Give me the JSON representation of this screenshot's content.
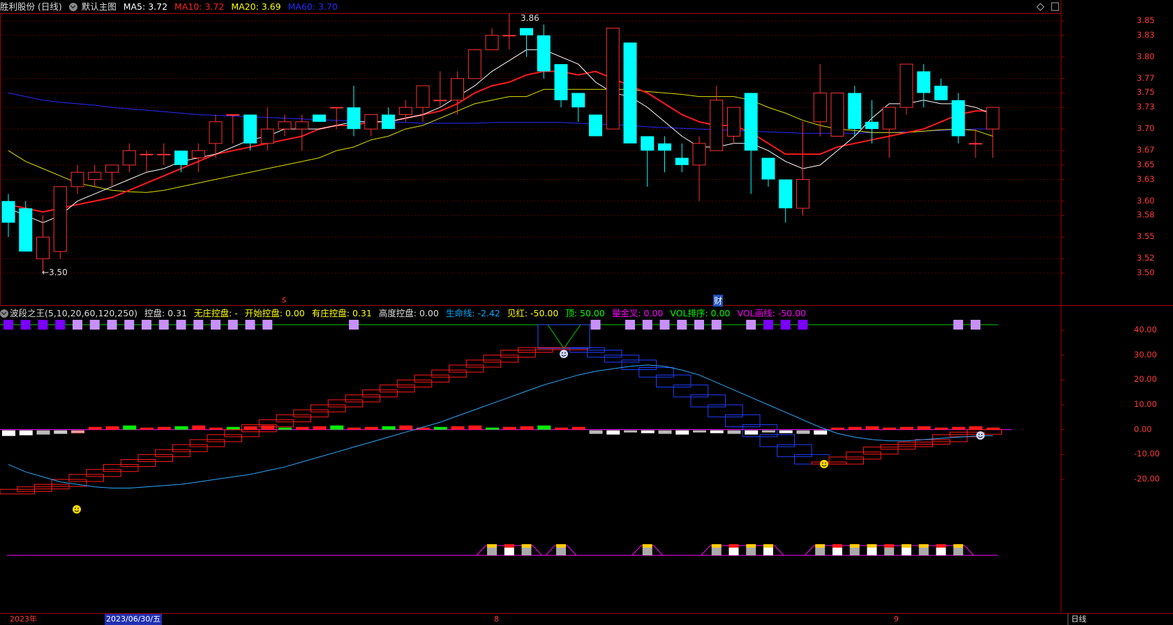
{
  "header": {
    "stock_title": "胜利股份 (日线)",
    "template_label": "默认主图",
    "ma5": {
      "label": "MA5:",
      "value": "3.72",
      "color": "#ffffff"
    },
    "ma10": {
      "label": "MA10:",
      "value": "3.72",
      "color": "#ff2020"
    },
    "ma20": {
      "label": "MA20:",
      "value": "3.69",
      "color": "#ffff00"
    },
    "ma60": {
      "label": "MA60:",
      "value": "3.70",
      "color": "#2020ff"
    }
  },
  "main_axis": {
    "ticks": [
      "3.85",
      "3.83",
      "3.80",
      "3.77",
      "3.75",
      "3.73",
      "3.70",
      "3.67",
      "3.65",
      "3.63",
      "3.60",
      "3.58",
      "3.55",
      "3.52",
      "3.50"
    ],
    "high_label": "3.86",
    "low_label": "←3.50",
    "marker_s": "s",
    "marker_cai": "财"
  },
  "sub1": {
    "title": "波段之王(5,10,20,60,120,250)",
    "items": [
      {
        "text": "控盘: 0.31",
        "color": "#dddddd"
      },
      {
        "text": "无庄控盘: -",
        "color": "#ffff00"
      },
      {
        "text": "开始控盘: 0.00",
        "color": "#ffff00"
      },
      {
        "text": "有庄控盘: 0.31",
        "color": "#ffff00"
      },
      {
        "text": "高度控盘: 0.00",
        "color": "#dddddd"
      },
      {
        "text": "生命线: -2.42",
        "color": "#00aaff"
      },
      {
        "text": "见红: -50.00",
        "color": "#ffff00"
      },
      {
        "text": "顶: 50.00",
        "color": "#00ff00"
      },
      {
        "text": "量金叉: 0.00",
        "color": "#ff00ff"
      },
      {
        "text": "VOL排序: 0.00",
        "color": "#00ff00"
      },
      {
        "text": "VOL画线: -50.00",
        "color": "#ff00ff"
      }
    ],
    "axis_ticks": [
      "40.00",
      "30.00",
      "20.00",
      "10.00",
      "0.00",
      "-10.00",
      "-20.00"
    ]
  },
  "bottom": {
    "year_label": "2023年",
    "date_label": "2023/06/30/五",
    "month8": "8",
    "month9": "9",
    "period_button": "日线"
  },
  "chart_data": {
    "type": "candlestick",
    "ylim": [
      3.49,
      3.86
    ],
    "colors": {
      "up": "#ff3232",
      "down": "#00ffff"
    },
    "candles": [
      [
        3.6,
        3.57,
        3.61,
        3.55
      ],
      [
        3.59,
        3.53,
        3.6,
        3.53
      ],
      [
        3.52,
        3.55,
        3.58,
        3.5
      ],
      [
        3.53,
        3.62,
        3.62,
        3.52
      ],
      [
        3.62,
        3.64,
        3.65,
        3.61
      ],
      [
        3.63,
        3.64,
        3.65,
        3.62
      ],
      [
        3.64,
        3.65,
        3.65,
        3.62
      ],
      [
        3.65,
        3.67,
        3.68,
        3.64
      ],
      [
        3.665,
        3.665,
        3.67,
        3.64
      ],
      [
        3.665,
        3.665,
        3.68,
        3.65
      ],
      [
        3.67,
        3.65,
        3.67,
        3.64
      ],
      [
        3.66,
        3.67,
        3.68,
        3.64
      ],
      [
        3.68,
        3.71,
        3.72,
        3.66
      ],
      [
        3.72,
        3.72,
        3.72,
        3.68
      ],
      [
        3.72,
        3.68,
        3.72,
        3.67
      ],
      [
        3.68,
        3.7,
        3.73,
        3.67
      ],
      [
        3.7,
        3.71,
        3.72,
        3.69
      ],
      [
        3.7,
        3.71,
        3.72,
        3.67
      ],
      [
        3.72,
        3.71,
        3.72,
        3.71
      ],
      [
        3.73,
        3.73,
        3.73,
        3.7
      ],
      [
        3.73,
        3.7,
        3.76,
        3.69
      ],
      [
        3.7,
        3.72,
        3.72,
        3.69
      ],
      [
        3.72,
        3.7,
        3.73,
        3.7
      ],
      [
        3.72,
        3.73,
        3.74,
        3.71
      ],
      [
        3.73,
        3.76,
        3.76,
        3.71
      ],
      [
        3.74,
        3.74,
        3.78,
        3.73
      ],
      [
        3.74,
        3.77,
        3.78,
        3.72
      ],
      [
        3.77,
        3.81,
        3.81,
        3.77
      ],
      [
        3.81,
        3.83,
        3.84,
        3.81
      ],
      [
        3.83,
        3.83,
        3.86,
        3.81
      ],
      [
        3.84,
        3.83,
        3.84,
        3.8
      ],
      [
        3.83,
        3.78,
        3.845,
        3.77
      ],
      [
        3.79,
        3.74,
        3.79,
        3.73
      ],
      [
        3.75,
        3.73,
        3.75,
        3.71
      ],
      [
        3.72,
        3.69,
        3.72,
        3.69
      ],
      [
        3.7,
        3.84,
        3.84,
        3.7
      ],
      [
        3.82,
        3.68,
        3.82,
        3.68
      ],
      [
        3.69,
        3.67,
        3.69,
        3.62
      ],
      [
        3.68,
        3.67,
        3.69,
        3.64
      ],
      [
        3.66,
        3.65,
        3.68,
        3.64
      ],
      [
        3.65,
        3.68,
        3.69,
        3.6
      ],
      [
        3.67,
        3.74,
        3.76,
        3.67
      ],
      [
        3.69,
        3.73,
        3.73,
        3.68
      ],
      [
        3.75,
        3.67,
        3.75,
        3.61
      ],
      [
        3.66,
        3.63,
        3.66,
        3.62
      ],
      [
        3.63,
        3.59,
        3.63,
        3.57
      ],
      [
        3.59,
        3.63,
        3.71,
        3.58
      ],
      [
        3.71,
        3.75,
        3.79,
        3.69
      ],
      [
        3.69,
        3.75,
        3.75,
        3.69
      ],
      [
        3.75,
        3.7,
        3.76,
        3.69
      ],
      [
        3.71,
        3.7,
        3.74,
        3.68
      ],
      [
        3.7,
        3.73,
        3.73,
        3.66
      ],
      [
        3.73,
        3.79,
        3.79,
        3.72
      ],
      [
        3.78,
        3.75,
        3.79,
        3.73
      ],
      [
        3.76,
        3.74,
        3.77,
        3.74
      ],
      [
        3.74,
        3.69,
        3.75,
        3.68
      ],
      [
        3.68,
        3.68,
        3.7,
        3.66
      ],
      [
        3.7,
        3.73,
        3.73,
        3.66
      ]
    ],
    "ma5": [
      3.59,
      3.58,
      3.57,
      3.58,
      3.6,
      3.61,
      3.62,
      3.63,
      3.64,
      3.645,
      3.655,
      3.66,
      3.665,
      3.675,
      3.685,
      3.69,
      3.7,
      3.7,
      3.7,
      3.705,
      3.71,
      3.71,
      3.71,
      3.715,
      3.72,
      3.73,
      3.745,
      3.76,
      3.78,
      3.795,
      3.81,
      3.81,
      3.8,
      3.79,
      3.765,
      3.75,
      3.745,
      3.73,
      3.71,
      3.69,
      3.675,
      3.675,
      3.68,
      3.68,
      3.67,
      3.655,
      3.645,
      3.65,
      3.67,
      3.69,
      3.715,
      3.735,
      3.735,
      3.74,
      3.735,
      3.735,
      3.73,
      3.72
    ],
    "ma10": [
      3.595,
      3.59,
      3.585,
      3.59,
      3.595,
      3.6,
      3.605,
      3.615,
      3.625,
      3.635,
      3.645,
      3.655,
      3.665,
      3.67,
      3.675,
      3.68,
      3.685,
      3.69,
      3.7,
      3.705,
      3.705,
      3.71,
      3.71,
      3.715,
      3.72,
      3.725,
      3.735,
      3.75,
      3.76,
      3.765,
      3.775,
      3.78,
      3.78,
      3.775,
      3.78,
      3.77,
      3.76,
      3.75,
      3.735,
      3.72,
      3.71,
      3.705,
      3.705,
      3.695,
      3.68,
      3.665,
      3.665,
      3.665,
      3.675,
      3.68,
      3.685,
      3.69,
      3.695,
      3.7,
      3.71,
      3.72,
      3.725,
      3.725
    ],
    "ma20": [
      3.67,
      3.655,
      3.645,
      3.635,
      3.625,
      3.62,
      3.615,
      3.613,
      3.612,
      3.615,
      3.62,
      3.625,
      3.63,
      3.635,
      3.64,
      3.645,
      3.65,
      3.655,
      3.66,
      3.67,
      3.675,
      3.685,
      3.69,
      3.7,
      3.705,
      3.715,
      3.725,
      3.735,
      3.74,
      3.745,
      3.745,
      3.755,
      3.755,
      3.755,
      3.755,
      3.755,
      3.755,
      3.752,
      3.75,
      3.748,
      3.745,
      3.745,
      3.745,
      3.74,
      3.73,
      3.722,
      3.712,
      3.705,
      3.7,
      3.698,
      3.695,
      3.695,
      3.695,
      3.697,
      3.699,
      3.7,
      3.698,
      3.69
    ],
    "ma60": [
      3.75,
      3.745,
      3.74,
      3.737,
      3.735,
      3.733,
      3.73,
      3.728,
      3.726,
      3.724,
      3.722,
      3.72,
      3.719,
      3.718,
      3.717,
      3.716,
      3.715,
      3.714,
      3.713,
      3.712,
      3.711,
      3.71,
      3.71,
      3.709,
      3.708,
      3.708,
      3.708,
      3.708,
      3.709,
      3.709,
      3.709,
      3.709,
      3.709,
      3.708,
      3.707,
      3.706,
      3.705,
      3.703,
      3.702,
      3.701,
      3.7,
      3.699,
      3.698,
      3.697,
      3.696,
      3.695,
      3.694,
      3.694,
      3.694,
      3.694,
      3.695,
      3.695,
      3.696,
      3.697,
      3.698,
      3.699,
      3.7,
      3.7
    ],
    "sub_ylim": [
      -25,
      45
    ],
    "step_line_red": [
      -25,
      -24,
      -23,
      -22,
      -20,
      -18,
      -16,
      -14,
      -12,
      -10,
      -8,
      -6,
      -4,
      -2,
      0,
      2,
      4,
      6,
      8,
      10,
      12,
      14,
      16,
      18,
      20,
      22,
      24,
      26,
      28,
      30,
      32,
      33,
      33,
      33,
      32,
      30,
      28,
      25,
      22,
      18,
      14,
      10,
      6,
      2,
      -2,
      -6,
      -10,
      -13,
      -13,
      -11,
      -9,
      -7,
      -6,
      -5,
      -4,
      -2,
      -1,
      0
    ],
    "life_line": [
      -14,
      -17,
      -19,
      -21,
      -22,
      -23,
      -23.5,
      -23.5,
      -23,
      -22.5,
      -22,
      -21,
      -20,
      -19,
      -18,
      -16.5,
      -15,
      -13,
      -11,
      -9,
      -7,
      -5,
      -3,
      -1,
      1,
      3,
      5.5,
      8,
      10.5,
      13,
      15.5,
      18,
      20,
      22,
      23.5,
      24.5,
      25.5,
      26,
      25.5,
      24,
      22,
      19,
      16,
      13,
      10,
      7,
      4,
      1,
      -1.5,
      -3,
      -4,
      -4.5,
      -4.5,
      -4,
      -3.5,
      -3,
      -2.6,
      -2.42
    ]
  }
}
